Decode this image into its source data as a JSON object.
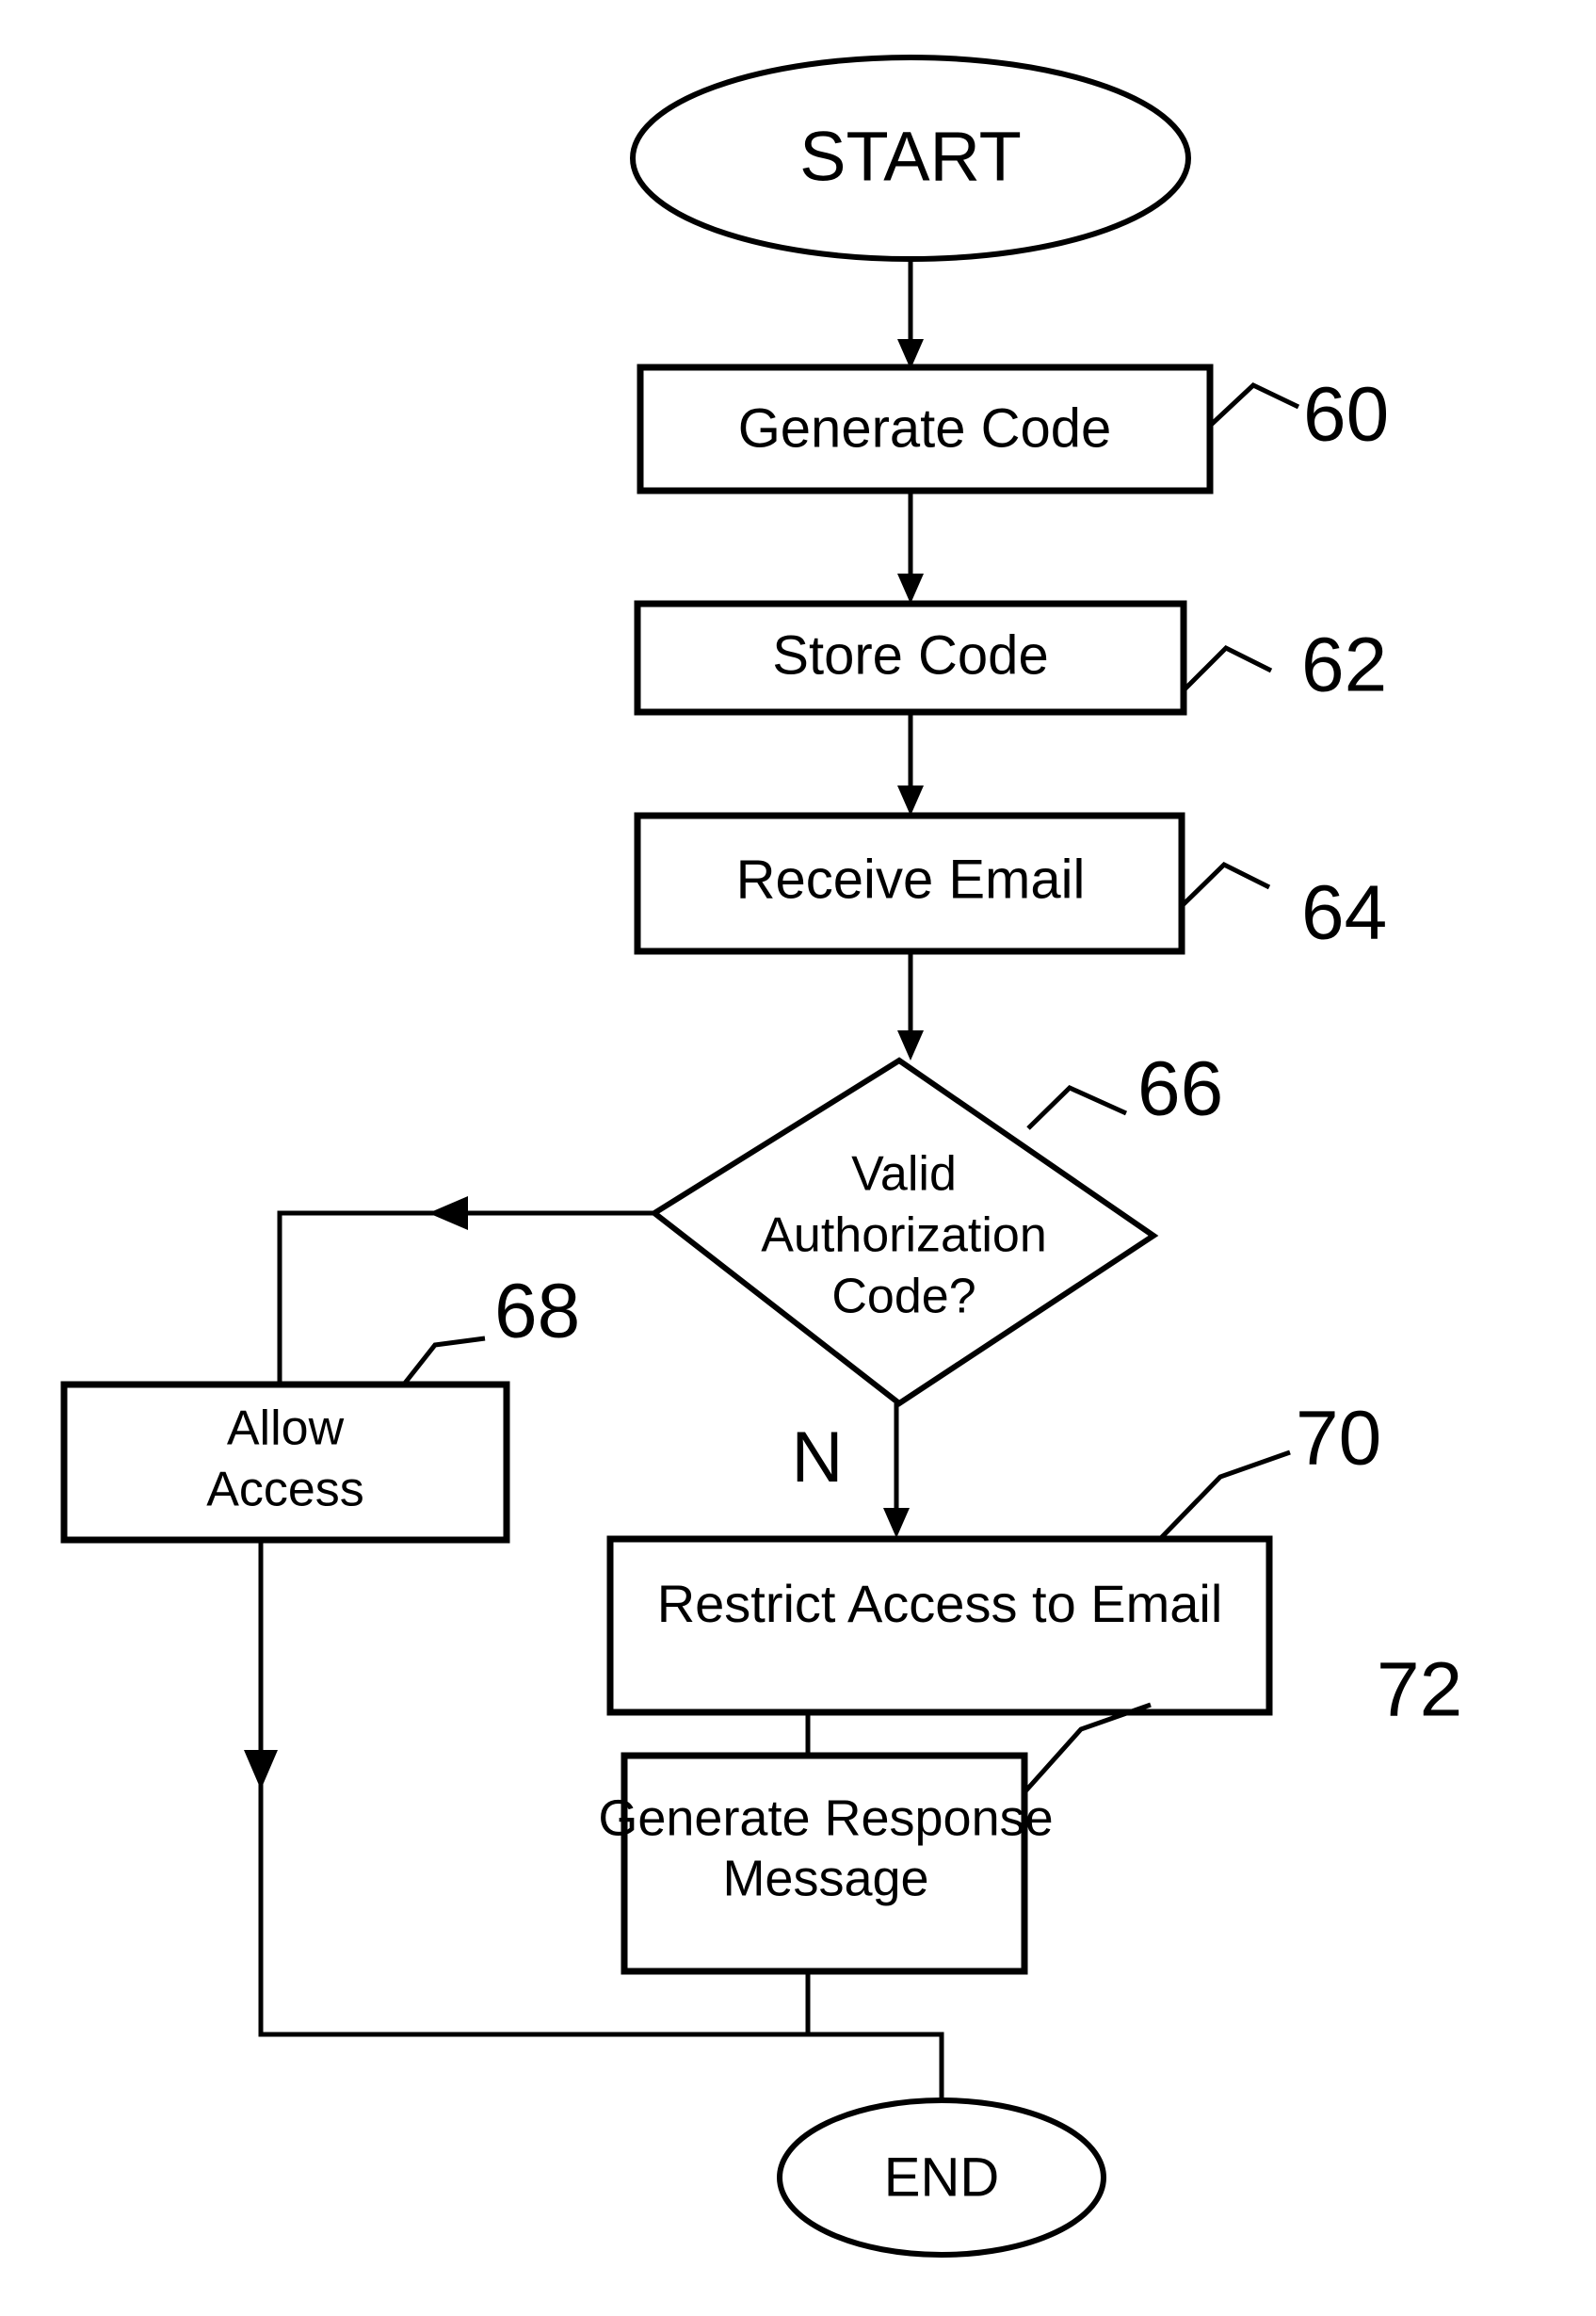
{
  "figure": {
    "type": "flowchart",
    "background_color": "#ffffff",
    "line_color": "#000000"
  },
  "nodes": {
    "start": {
      "label": "START",
      "shape": "ellipse"
    },
    "generate_code": {
      "label": "Generate Code",
      "shape": "rectangle",
      "ref": "60"
    },
    "store_code": {
      "label": "Store Code",
      "shape": "rectangle",
      "ref": "62"
    },
    "receive_email": {
      "label": "Receive Email",
      "shape": "rectangle",
      "ref": "64"
    },
    "decision": {
      "label_line1": "Valid",
      "label_line2": "Authorization",
      "label_line3": "Code?",
      "shape": "diamond",
      "ref": "66"
    },
    "allow_access": {
      "label_line1": "Allow",
      "label_line2": "Access",
      "shape": "rectangle",
      "ref": "68"
    },
    "restrict_access": {
      "label": "Restrict Access to Email",
      "shape": "rectangle",
      "ref": "70"
    },
    "generate_response": {
      "label_line1": "Generate Response",
      "label_line2": "Message",
      "shape": "rectangle",
      "ref": "72"
    },
    "end": {
      "label": "END",
      "shape": "ellipse"
    }
  },
  "edges": {
    "no_branch_label": "N"
  },
  "reference_numerals": {
    "n60": "60",
    "n62": "62",
    "n64": "64",
    "n66": "66",
    "n68": "68",
    "n70": "70",
    "n72": "72"
  }
}
